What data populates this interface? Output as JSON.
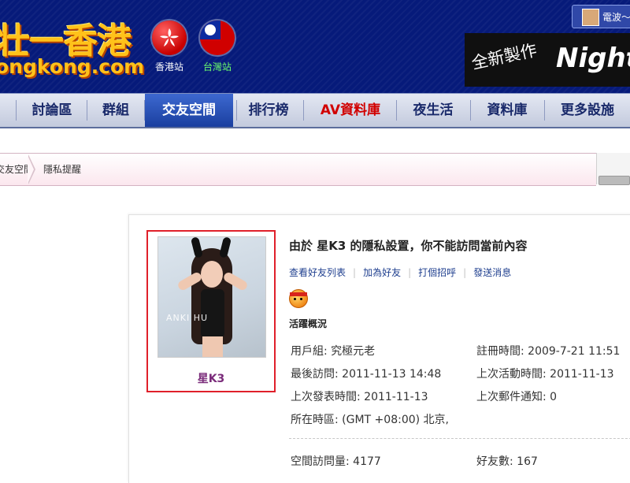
{
  "header": {
    "logo_cn": "壮一香港",
    "logo_en": "ongkong.com",
    "sites": [
      {
        "label": "香港站",
        "color": "#ffffff"
      },
      {
        "label": "台灣站",
        "color": "#6cff6c"
      }
    ],
    "user_name": "電波～",
    "banner_jp": "全新製作",
    "banner_text": "Night"
  },
  "nav": [
    {
      "label": "討論區"
    },
    {
      "label": "群組"
    },
    {
      "label": "交友空間",
      "active": true
    },
    {
      "label": "排行榜"
    },
    {
      "label": "AV資料庫",
      "accent": "#d10000"
    },
    {
      "label": "夜生活"
    },
    {
      "label": "資料庫"
    },
    {
      "label": "更多設施"
    }
  ],
  "breadcrumb": [
    "交友空間",
    "隱私提醒"
  ],
  "profile": {
    "name": "星K3",
    "photo_watermark": "ANKI HU",
    "privacy_message": "由於 星K3 的隱私設置，你不能訪問當前內容",
    "actions": [
      "查看好友列表",
      "加為好友",
      "打個招呼",
      "發送消息"
    ],
    "activity_title": "活躍概況",
    "stats_left": [
      "用戶組: 究極元老",
      "最後訪問: 2011-11-13 14:48",
      "上次發表時間: 2011-11-13",
      "所在時區: (GMT +08:00) 北京,"
    ],
    "stats_right": [
      "註冊時間: 2009-7-21 11:51",
      "上次活動時間: 2011-11-13",
      "上次郵件通知: 0"
    ],
    "space_visits": "空間訪問量: 4177",
    "friends_count": "好友數: 167"
  }
}
